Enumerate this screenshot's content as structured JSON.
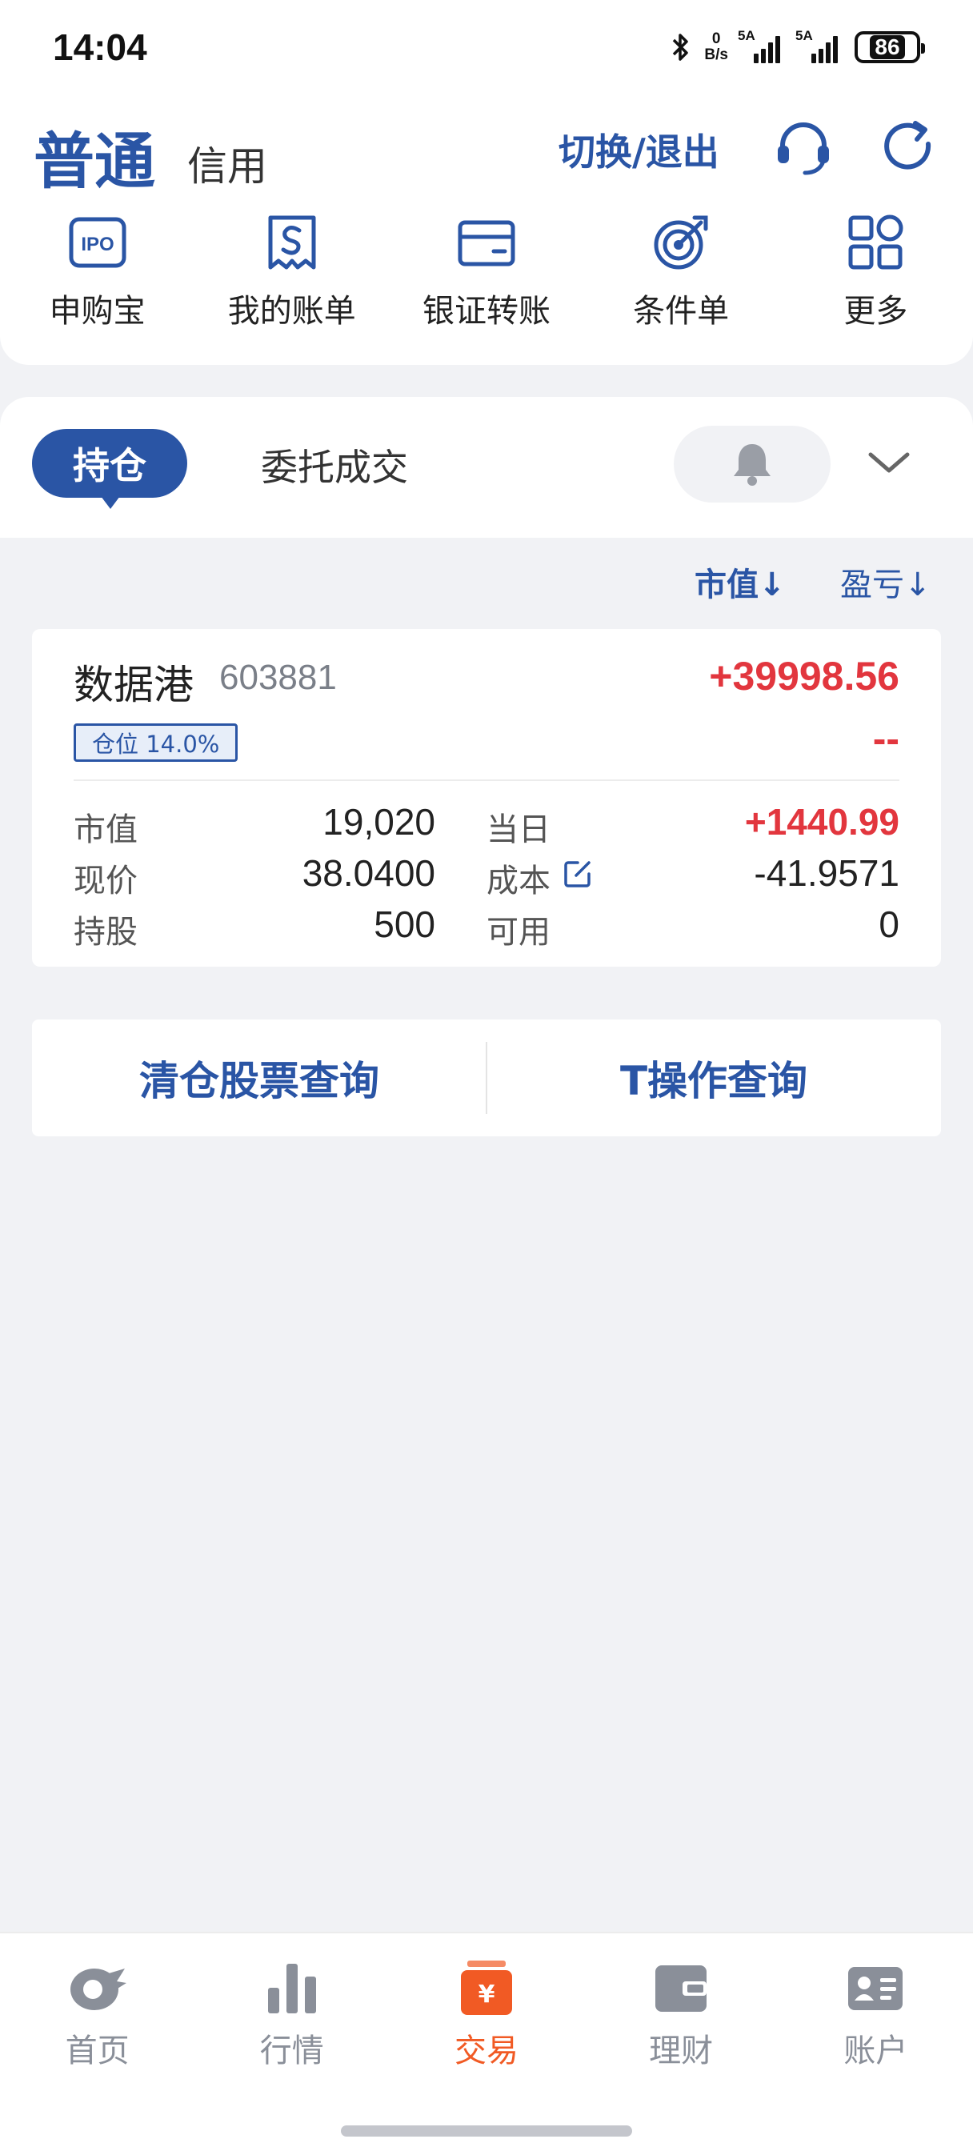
{
  "status_bar": {
    "time": "14:04",
    "net_speed_value": "0",
    "net_speed_unit": "B/s",
    "signal1_label": "5A",
    "signal2_label": "5A",
    "battery": "86"
  },
  "header": {
    "account_normal": "普通",
    "account_credit": "信用",
    "switch_exit": "切换/退出"
  },
  "shortcuts": [
    {
      "label": "申购宝",
      "icon": "ipo-icon"
    },
    {
      "label": "我的账单",
      "icon": "bill-icon"
    },
    {
      "label": "银证转账",
      "icon": "card-icon"
    },
    {
      "label": "条件单",
      "icon": "target-icon"
    },
    {
      "label": "更多",
      "icon": "grid-icon"
    }
  ],
  "tabs": {
    "holdings": "持仓",
    "orders": "委托成交"
  },
  "sort": {
    "market_value": "市值↓",
    "profit_loss": "盈亏↓"
  },
  "position": {
    "name": "数据港",
    "code": "603881",
    "total_pl": "+39998.56",
    "position_ratio": "仓位 14.0%",
    "pl_ratio": "--",
    "rows": {
      "market_value_label": "市值",
      "market_value": "19,020",
      "today_label": "当日",
      "today": "+1440.99",
      "price_label": "现价",
      "price": "38.0400",
      "cost_label": "成本",
      "cost": "-41.9571",
      "shares_label": "持股",
      "shares": "500",
      "available_label": "可用",
      "available": "0"
    }
  },
  "queries": {
    "cleared_stocks": "清仓股票查询",
    "t_operation": "T操作查询"
  },
  "nav": [
    {
      "label": "首页",
      "icon": "home-icon",
      "active": false
    },
    {
      "label": "行情",
      "icon": "market-icon",
      "active": false
    },
    {
      "label": "交易",
      "icon": "trade-icon",
      "active": true
    },
    {
      "label": "理财",
      "icon": "wallet-icon",
      "active": false
    },
    {
      "label": "账户",
      "icon": "account-icon",
      "active": false
    }
  ],
  "colors": {
    "brand_blue": "#2a55a5",
    "gain_red": "#e2363e",
    "active_orange": "#f15a24"
  }
}
